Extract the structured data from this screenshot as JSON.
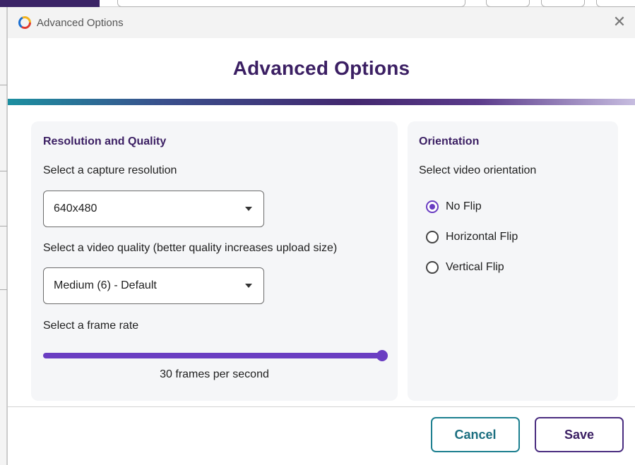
{
  "window": {
    "title": "Advanced Options",
    "close_glyph": "✕"
  },
  "header": {
    "title": "Advanced Options"
  },
  "resolution_panel": {
    "title": "Resolution and Quality",
    "resolution_label": "Select a capture resolution",
    "resolution_value": "640x480",
    "quality_label": "Select a video quality (better quality increases upload size)",
    "quality_value": "Medium (6) - Default",
    "frame_rate_label": "Select a frame rate",
    "frame_rate_fraction": 1.0,
    "frame_rate_caption": "30 frames per second"
  },
  "orientation_panel": {
    "title": "Orientation",
    "label": "Select video orientation",
    "options": [
      {
        "label": "No Flip",
        "checked": true
      },
      {
        "label": "Horizontal Flip",
        "checked": false
      },
      {
        "label": "Vertical Flip",
        "checked": false
      }
    ]
  },
  "footer": {
    "cancel_label": "Cancel",
    "save_label": "Save"
  },
  "colors": {
    "accent": "#6a3dc2",
    "title": "#3b1f63",
    "cancel_border": "#1c7f8f"
  }
}
